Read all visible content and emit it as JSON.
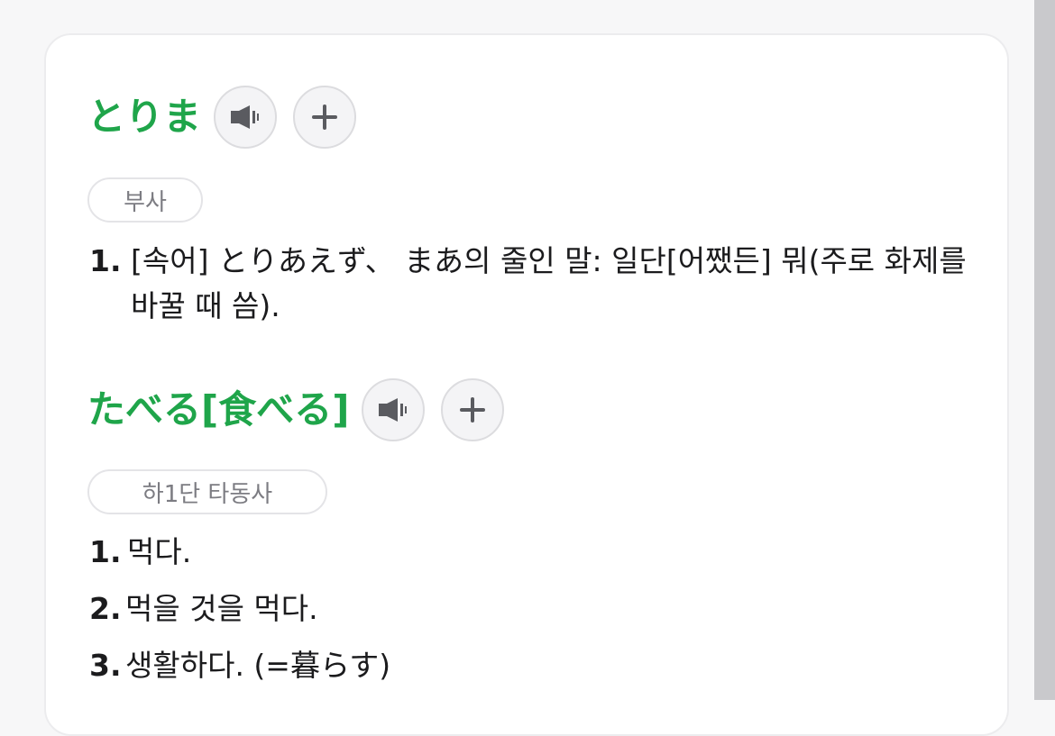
{
  "entries": [
    {
      "headword": "とりま",
      "audio_icon": "speaker-icon",
      "add_icon": "plus-icon",
      "pos": "부사",
      "senses": [
        {
          "num": "1.",
          "text": "[속어] とりあえず、 まあ의 줄인 말: 일단[어쨌든] 뭐(주로 화제를 바꿀 때 씀)."
        }
      ]
    },
    {
      "headword": "たべる[食べる]",
      "audio_icon": "speaker-icon",
      "add_icon": "plus-icon",
      "pos": "하1단 타동사",
      "senses": [
        {
          "num": "1.",
          "text": "먹다."
        },
        {
          "num": "2.",
          "text": "먹을 것을 먹다."
        },
        {
          "num": "3.",
          "text": "생활하다. (=暮らす)"
        }
      ]
    }
  ],
  "colors": {
    "headword": "#1fa54a",
    "badge_text": "#7c7c82",
    "body_text": "#1b1b1d",
    "icon": "#5a5b60"
  }
}
